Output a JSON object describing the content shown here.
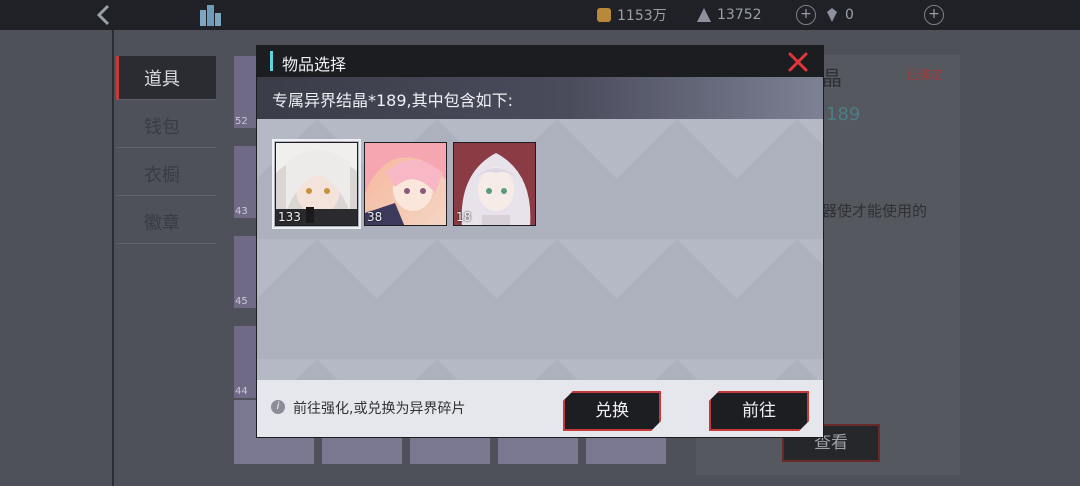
{
  "topbar": {
    "gold": "1153万",
    "crystals": "13752",
    "gems": "0",
    "icons": {
      "back": "back-arrow-icon",
      "base": "base-building-icon",
      "gold": "gold-coin-icon",
      "crystal": "crystal-pyramid-icon",
      "gem": "diamond-icon",
      "add": "plus-icon"
    }
  },
  "sidebar": {
    "tabs": [
      {
        "label": "道具",
        "active": true
      },
      {
        "label": "钱包",
        "active": false
      },
      {
        "label": "衣橱",
        "active": false
      },
      {
        "label": "徽章",
        "active": false
      }
    ]
  },
  "inventory": {
    "left_counts": [
      "52",
      "43",
      "45",
      "44"
    ]
  },
  "detail": {
    "title": "晶",
    "bound": "已绑定",
    "amount": "189",
    "desc": "器使才能使用的",
    "view_label": "查看"
  },
  "modal": {
    "title": "物品选择",
    "subtitle": "专属异界结晶*189,其中包含如下:",
    "items": [
      {
        "count": "133",
        "icon": "character-portrait-white-hair-icon",
        "selected": true
      },
      {
        "count": "38",
        "icon": "character-portrait-pink-hair-icon",
        "selected": false
      },
      {
        "count": "18",
        "icon": "character-portrait-silver-hair-icon",
        "selected": false
      }
    ],
    "footer_note": "前往强化,或兑换为异界碎片",
    "exchange_label": "兑换",
    "goto_label": "前往",
    "colors": {
      "accent": "#5fd4e0",
      "close": "#e2363a",
      "button_border": "#c43a3a"
    }
  }
}
